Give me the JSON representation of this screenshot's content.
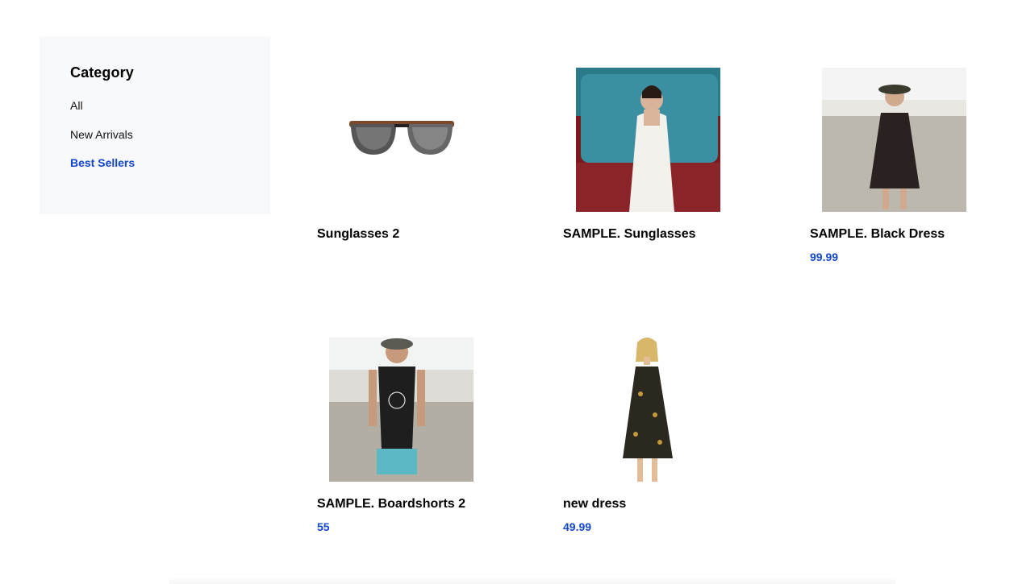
{
  "sidebar": {
    "title": "Category",
    "items": [
      {
        "label": "All",
        "active": false
      },
      {
        "label": "New Arrivals",
        "active": false
      },
      {
        "label": "Best Sellers",
        "active": true
      }
    ]
  },
  "products": [
    {
      "name": "Sunglasses 2",
      "price": "",
      "image": "sunglasses-image"
    },
    {
      "name": "SAMPLE. Sunglasses",
      "price": "",
      "image": "woman-white-dress-car-image"
    },
    {
      "name": "SAMPLE. Black Dress",
      "price": "99.99",
      "image": "woman-black-dress-beach-image"
    },
    {
      "name": "SAMPLE. Boardshorts 2",
      "price": "55",
      "image": "man-boardshorts-beach-image"
    },
    {
      "name": "new dress",
      "price": "49.99",
      "image": "woman-floral-dress-image"
    }
  ],
  "colors": {
    "accent": "#1347c9",
    "sidebar_bg": "#f8f9fa"
  }
}
